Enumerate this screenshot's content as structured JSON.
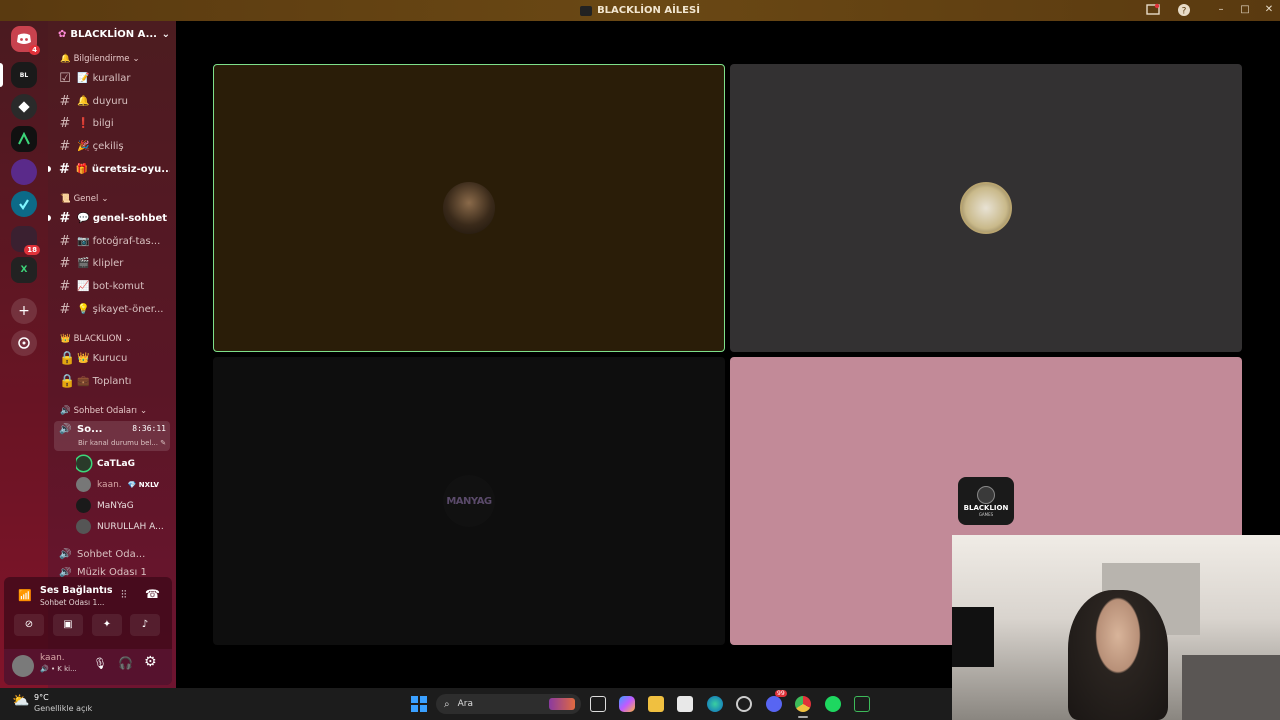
{
  "window": {
    "title": "BLACKLİON AİLESİ"
  },
  "server": {
    "name": "BLACKLİON A...",
    "rail_badge_1": "4",
    "rail_badge_2": "18"
  },
  "categories": {
    "info": "Bilgilendirme",
    "general": "Genel",
    "blacklion": "BLACKLION",
    "voice_rooms": "Sohbet Odaları"
  },
  "channels": {
    "kurallar": "📝 kurallar",
    "duyuru": "🔔 duyuru",
    "bilgi": "❗ bilgi",
    "cekilis": "🎉 çekiliş",
    "ucretsiz": "🎁 ücretsiz-oyu...",
    "genel_sohbet": "💬 genel-sohbet",
    "fotograf": "📷 fotoğraf-tas...",
    "klipler": "🎬 klipler",
    "bot_komut": "📈 bot-komut",
    "sikayet": "💡 şikayet-öner...",
    "kurucu": "👑 Kurucu",
    "toplanti": "💼 Toplantı",
    "voice_active": "So...",
    "voice_timer": "8:36:11",
    "voice_status": "Bir kanal durumu bel...",
    "sohbet_oda": "Sohbet Oda...",
    "muzik_oda": "Müzik Odası 1"
  },
  "voice_users": [
    {
      "name": "CaTLaG"
    },
    {
      "name": "kaan.",
      "tag": "💎 NXLV"
    },
    {
      "name": "MaNYaG"
    },
    {
      "name": "NURULLAH A..."
    }
  ],
  "voice_panel": {
    "status": "Ses Bağlantısı K",
    "channel": "Sohbet Odası 1...",
    "user_name": "kaan.",
    "user_sub": "🔊 • K ki..."
  },
  "tiles": {
    "manyag_text": "MANYAG",
    "blacklion_logo_text": "BLACKLION",
    "blacklion_logo_sub": "GAMES"
  },
  "taskbar": {
    "weather_temp": "9°C",
    "weather_desc": "Genellikle açık",
    "search_label": "Ara",
    "discord_badge": "99"
  },
  "colors": {
    "speaking_border": "#7ee08a",
    "tile1_bg": "#2a1d08",
    "tile2_bg": "#333132",
    "tile3_bg": "#0e0e0e",
    "tile4_bg": "#c28a98"
  }
}
